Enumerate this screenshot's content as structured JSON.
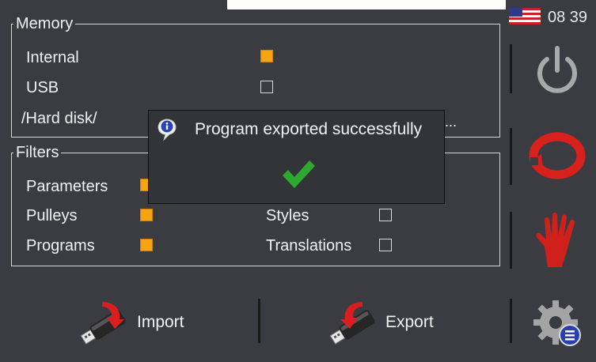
{
  "status": {
    "time": "08 39",
    "flag_icon": "us-flag-icon"
  },
  "memory": {
    "legend": "Memory",
    "options": [
      {
        "label": "Internal",
        "checked": true
      },
      {
        "label": "USB",
        "checked": false
      }
    ],
    "path": "/Hard disk/",
    "path_ellipsis": "..."
  },
  "filters": {
    "legend": "Filters",
    "items": [
      {
        "label": "Parameters",
        "checked": true
      },
      {
        "label": "Pulleys",
        "checked": true
      },
      {
        "label": "Programs",
        "checked": true
      },
      {
        "label": "Styles",
        "checked": false
      },
      {
        "label": "Translations",
        "checked": false
      }
    ]
  },
  "dialog": {
    "message": "Program exported successfully",
    "icon": "info-icon",
    "status_icon": "checkmark-icon"
  },
  "actions": {
    "import_label": "Import",
    "export_label": "Export"
  },
  "side": {
    "icons": [
      "power-icon",
      "refresh-icon",
      "stop-hand-icon",
      "settings-icon"
    ]
  },
  "colors": {
    "background": "#3b3c41",
    "checkbox_on": "#f6a411",
    "check_green": "#2fa82f",
    "refresh_red": "#d8201c"
  }
}
